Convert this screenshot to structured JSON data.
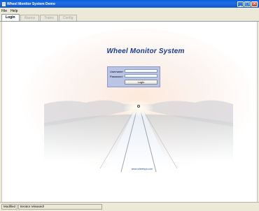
{
  "window": {
    "title": "Wheel Monitor System Demo"
  },
  "menu": {
    "items": [
      "File",
      "Help"
    ]
  },
  "tabs": [
    {
      "label": "Login",
      "active": true
    },
    {
      "label": "Alarms",
      "active": false
    },
    {
      "label": "Trains",
      "active": false
    },
    {
      "label": "Config",
      "active": false
    }
  ],
  "main": {
    "app_title": "Wheel Monitor System",
    "login": {
      "username_label": "Username:",
      "password_label": "Password:",
      "username_value": "",
      "password_value": "",
      "login_button": "Login"
    },
    "website": "www.wheelsys.com"
  },
  "status": {
    "mode": "Modified",
    "message": "Iterator released!"
  },
  "colors": {
    "title_bar": "#0a5fd8",
    "app_title": "#1a3b8c",
    "login_panel": "#b9c4e6"
  }
}
